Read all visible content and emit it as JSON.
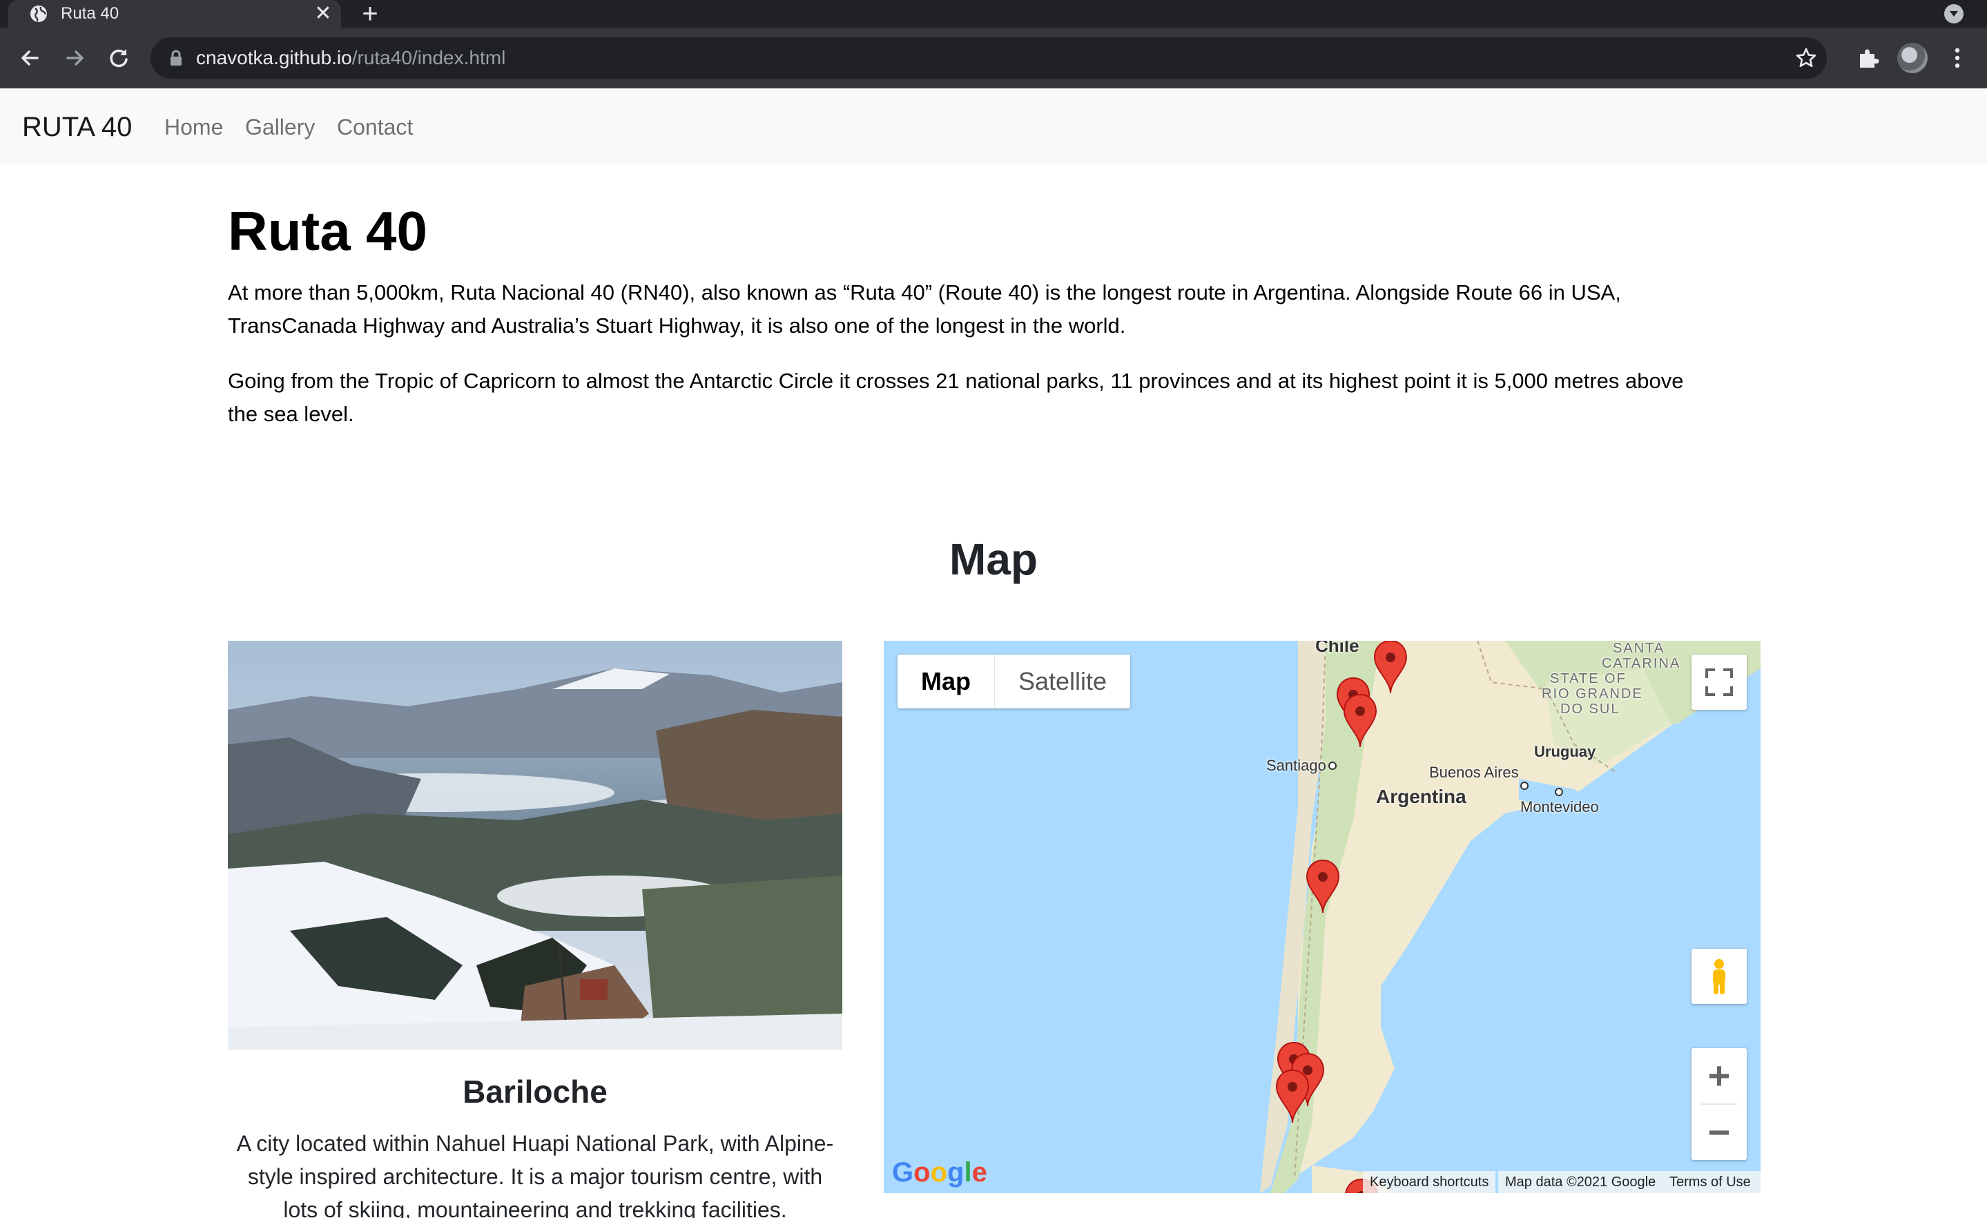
{
  "browser": {
    "tab_title": "Ruta 40",
    "tab_close": "✕",
    "new_tab": "+",
    "url_host": "cnavotka.github.io",
    "url_path": "/ruta40/index.html"
  },
  "navbar": {
    "brand": "RUTA 40",
    "links": [
      "Home",
      "Gallery",
      "Contact"
    ]
  },
  "intro": {
    "title": "Ruta 40",
    "paragraph1_line1": "At more than 5,000km, Ruta Nacional 40 (RN40), also known as “Ruta 40” (Route 40) is the longest route in Argentina. Alongside Route 66 in USA,",
    "paragraph1_line2": "TransCanada Highway and Australia’s Stuart Highway, it is also one of the longest in the world.",
    "paragraph2_line1": "Going from the Tropic of Capricorn to almost the Antarctic Circle it crosses 21 national parks, 11 provinces and at its highest point it is 5,000 metres above",
    "paragraph2_line2": "the sea level."
  },
  "map_section": {
    "title": "Map",
    "card": {
      "title": "Bariloche",
      "text_line1": "A city located within Nahuel Huapi National Park, with Alpine-",
      "text_line2": "style inspired architecture. It is a major tourism centre, with",
      "text_line3": "lots of skiing, mountaineering and trekking facilities."
    },
    "map": {
      "type_buttons": [
        "Map",
        "Satellite"
      ],
      "labels": {
        "chile": "Chile",
        "santa_catarina_1": "SANTA",
        "santa_catarina_2": "CATARINA",
        "rio_grande_1": "STATE OF",
        "rio_grande_2": "RIO GRANDE",
        "rio_grande_3": "DO SUL",
        "uruguay": "Uruguay",
        "santiago": "Santiago",
        "buenos_aires": "Buenos Aires",
        "argentina": "Argentina",
        "montevideo": "Montevideo"
      },
      "zoom_in": "+",
      "zoom_out": "−",
      "attribution": {
        "shortcuts": "Keyboard shortcuts",
        "data": "Map data ©2021 Google",
        "terms": "Terms of Use"
      },
      "logo": "Google",
      "marker_color": "#ea4335"
    }
  }
}
